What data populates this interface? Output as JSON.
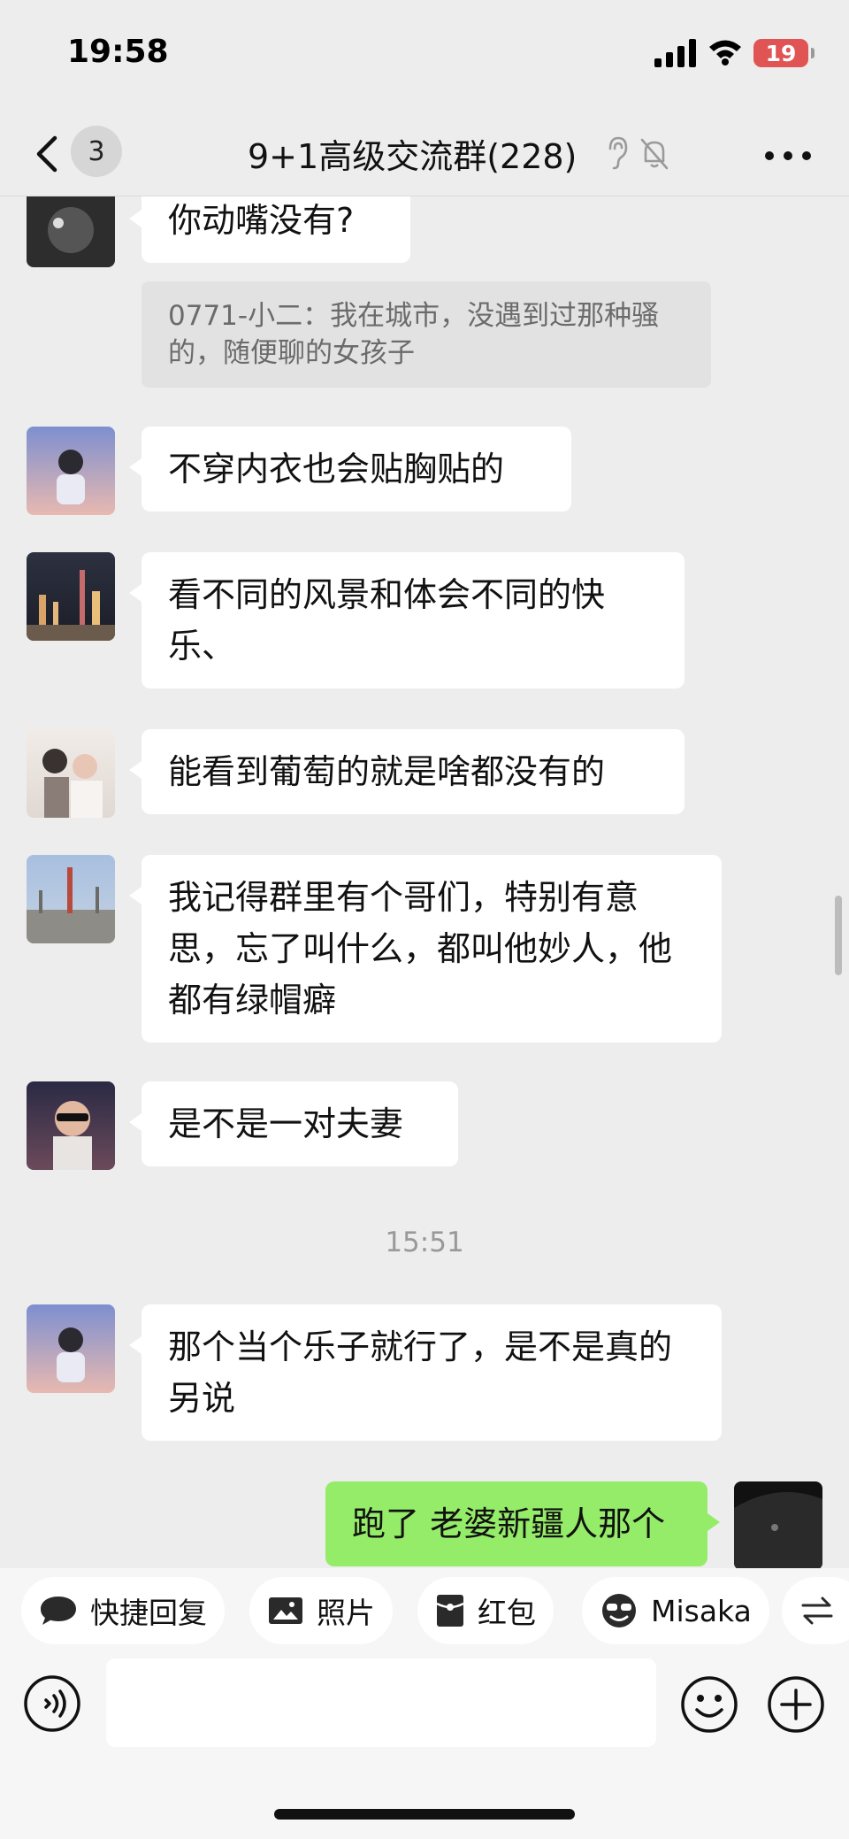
{
  "status_bar": {
    "time": "19:58",
    "battery": "19"
  },
  "nav": {
    "back_icon": "chevron-left-icon",
    "unread_count": "3",
    "title": "9+1高级交流群(228)",
    "icons": [
      "ear-icon",
      "bell-muted-icon",
      "more-icon"
    ]
  },
  "messages": [
    {
      "type": "text",
      "text": "你动嘴没有?"
    },
    {
      "type": "quote",
      "text": "0771-小二：我在城市，没遇到过那种骚的，随便聊的女孩子"
    },
    {
      "type": "text",
      "text": "不穿内衣也会贴胸贴的"
    },
    {
      "type": "text",
      "text": "看不同的风景和体会不同的快乐、"
    },
    {
      "type": "text",
      "text": "能看到葡萄的就是啥都没有的"
    },
    {
      "type": "text",
      "text": "我记得群里有个哥们，特别有意思，忘了叫什么，都叫他妙人，他都有绿帽癖"
    },
    {
      "type": "text",
      "text": "是不是一对夫妻"
    },
    {
      "type": "timestamp",
      "text": "15:51"
    },
    {
      "type": "text",
      "text": "那个当个乐子就行了，是不是真的另说"
    },
    {
      "type": "mine",
      "text": "跑了 老婆新疆人那个"
    }
  ],
  "quick_bar": {
    "items": [
      {
        "label": "快捷回复",
        "icon": "speech-bubble-icon"
      },
      {
        "label": "照片",
        "icon": "image-icon"
      },
      {
        "label": "红包",
        "icon": "red-packet-icon"
      },
      {
        "label": "Misaka",
        "icon": "sunglasses-face-icon"
      },
      {
        "label": "",
        "icon": "swap-arrows-icon"
      }
    ]
  },
  "input_bar": {
    "voice_icon": "voice-icon",
    "placeholder": "",
    "emoji_icon": "emoji-icon",
    "plus_icon": "plus-icon"
  },
  "colors": {
    "background": "#ededed",
    "bubble_incoming": "#ffffff",
    "bubble_outgoing": "#95ec69",
    "battery": "#e05454"
  }
}
